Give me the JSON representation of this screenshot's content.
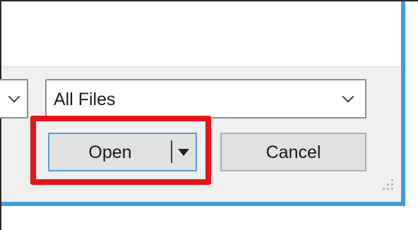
{
  "filetype_dropdown": {
    "value": "All Files",
    "icon": "chevron-down-icon"
  },
  "left_dropdown": {
    "icon": "chevron-down-icon"
  },
  "buttons": {
    "open_label": "Open",
    "open_split_icon": "caret-down-icon",
    "cancel_label": "Cancel"
  },
  "colors": {
    "highlight": "#e8141b",
    "window_border": "#3c9fd9",
    "default_button_border": "#5a9bd5",
    "button_face": "#e1e1e1",
    "dialog_background": "#f0f0f0"
  }
}
